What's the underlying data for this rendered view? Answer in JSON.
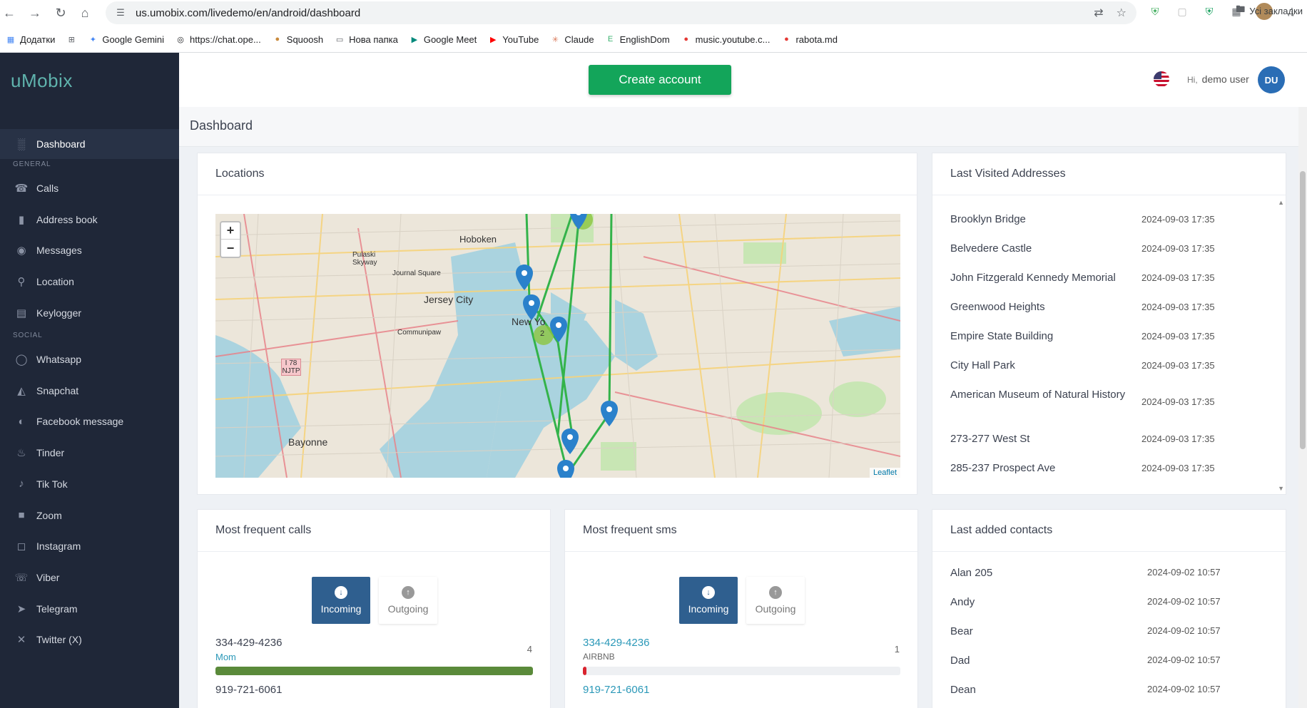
{
  "browser": {
    "url": "us.umobix.com/livedemo/en/android/dashboard",
    "bookmarks": [
      {
        "label": "Додатки",
        "icon": "apps-grid-icon",
        "color": "#4285f4"
      },
      {
        "label": "",
        "icon": "grid-icon",
        "color": "#5f6368"
      },
      {
        "label": "Google Gemini",
        "icon": "gemini-icon",
        "color": "#4285f4"
      },
      {
        "label": "https://chat.ope...",
        "icon": "chatgpt-icon",
        "color": "#202124"
      },
      {
        "label": "Squoosh",
        "icon": "squoosh-icon",
        "color": "#c98a3c"
      },
      {
        "label": "Нова папка",
        "icon": "folder-icon",
        "color": "#5f6368"
      },
      {
        "label": "Google Meet",
        "icon": "meet-icon",
        "color": "#00897b"
      },
      {
        "label": "YouTube",
        "icon": "youtube-icon",
        "color": "#ff0000"
      },
      {
        "label": "Claude",
        "icon": "claude-icon",
        "color": "#d97757"
      },
      {
        "label": "EnglishDom",
        "icon": "englishdom-icon",
        "color": "#3cb371"
      },
      {
        "label": "music.youtube.c...",
        "icon": "youtube-music-icon",
        "color": "#e53935"
      },
      {
        "label": "rabota.md",
        "icon": "rabota-icon",
        "color": "#e53935"
      }
    ],
    "all_bookmarks": "Усі закладки"
  },
  "app": {
    "logo": "uMobix",
    "create_account": "Create account",
    "greeting_hi": "Hi,",
    "greeting_name": "demo user",
    "avatar_initials": "DU",
    "page_title": "Dashboard"
  },
  "sidebar": {
    "active": {
      "label": "Dashboard",
      "icon": "bar-chart-icon"
    },
    "sections": [
      {
        "title": "GENERAL",
        "items": [
          {
            "label": "Calls",
            "icon": "phone-icon"
          },
          {
            "label": "Address book",
            "icon": "address-book-icon"
          },
          {
            "label": "Messages",
            "icon": "chat-bubble-icon"
          },
          {
            "label": "Location",
            "icon": "location-pin-icon"
          },
          {
            "label": "Keylogger",
            "icon": "keyboard-icon"
          }
        ]
      },
      {
        "title": "SOCIAL",
        "items": [
          {
            "label": "Whatsapp",
            "icon": "whatsapp-icon"
          },
          {
            "label": "Snapchat",
            "icon": "snapchat-icon"
          },
          {
            "label": "Facebook message",
            "icon": "messenger-icon"
          },
          {
            "label": "Tinder",
            "icon": "tinder-flame-icon"
          },
          {
            "label": "Tik Tok",
            "icon": "tiktok-icon"
          },
          {
            "label": "Zoom",
            "icon": "video-camera-icon"
          },
          {
            "label": "Instagram",
            "icon": "instagram-icon"
          },
          {
            "label": "Viber",
            "icon": "viber-icon"
          },
          {
            "label": "Telegram",
            "icon": "telegram-icon"
          },
          {
            "label": "Twitter (X)",
            "icon": "x-icon"
          }
        ]
      }
    ]
  },
  "locations": {
    "title": "Locations",
    "zoom_in": "+",
    "zoom_out": "−",
    "attribution": "Leaflet",
    "cluster_count": "2",
    "labels": [
      "Hoboken",
      "Jersey City",
      "New Yo",
      "Bayonne",
      "Pulaski Skyway",
      "Journal Square",
      "Communipaw",
      "I 78 NJTP"
    ]
  },
  "last_visited": {
    "title": "Last Visited Addresses",
    "rows": [
      {
        "name": "Brooklyn Bridge",
        "time": "2024-09-03 17:35"
      },
      {
        "name": "Belvedere Castle",
        "time": "2024-09-03 17:35"
      },
      {
        "name": "John Fitzgerald Kennedy Memorial",
        "time": "2024-09-03 17:35"
      },
      {
        "name": "Greenwood Heights",
        "time": "2024-09-03 17:35"
      },
      {
        "name": "Empire State Building",
        "time": "2024-09-03 17:35"
      },
      {
        "name": "City Hall Park",
        "time": "2024-09-03 17:35"
      },
      {
        "name": "American Museum of Natural History",
        "time": "2024-09-03 17:35"
      },
      {
        "name": "273-277 West St",
        "time": "2024-09-03 17:35"
      },
      {
        "name": "285-237 Prospect Ave",
        "time": "2024-09-03 17:35"
      }
    ]
  },
  "frequent_calls": {
    "title": "Most frequent calls",
    "incoming": "Incoming",
    "outgoing": "Outgoing",
    "entries": [
      {
        "number": "334-429-4236",
        "name": "Mom",
        "count": "4",
        "fill": 1.0,
        "color": "#5a8a3a"
      },
      {
        "number": "919-721-6061",
        "name": "",
        "count": "",
        "fill": 0,
        "color": "#5a8a3a"
      }
    ]
  },
  "frequent_sms": {
    "title": "Most frequent sms",
    "incoming": "Incoming",
    "outgoing": "Outgoing",
    "entries": [
      {
        "number": "334-429-4236",
        "name": "AIRBNB",
        "count": "1",
        "fill": 0.01,
        "color": "#d9232e"
      },
      {
        "number": "919-721-6061",
        "name": "",
        "count": "",
        "fill": 0,
        "color": "#d9232e"
      }
    ]
  },
  "last_contacts": {
    "title": "Last added contacts",
    "rows": [
      {
        "name": "Alan 205",
        "time": "2024-09-02 10:57"
      },
      {
        "name": "Andy",
        "time": "2024-09-02 10:57"
      },
      {
        "name": "Bear",
        "time": "2024-09-02 10:57"
      },
      {
        "name": "Dad",
        "time": "2024-09-02 10:57"
      },
      {
        "name": "Dean",
        "time": "2024-09-02 10:57"
      }
    ]
  }
}
